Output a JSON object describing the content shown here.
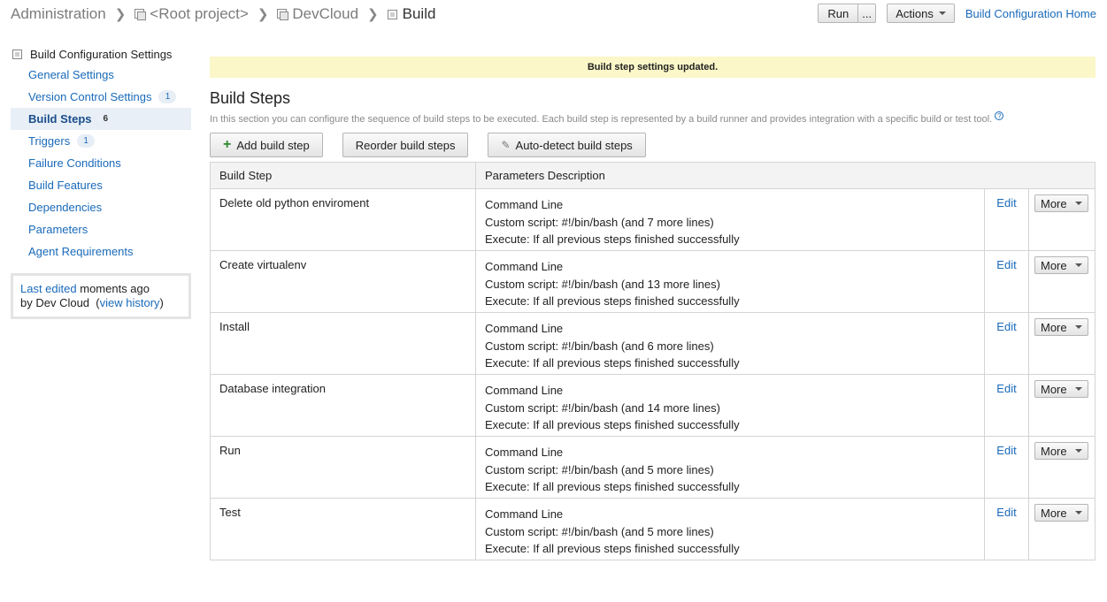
{
  "breadcrumb": [
    {
      "label": "Administration",
      "icon": ""
    },
    {
      "label": "<Root project>",
      "icon": "project-icon"
    },
    {
      "label": "DevCloud",
      "icon": "project-icon"
    },
    {
      "label": "Build",
      "icon": "build-config-icon"
    }
  ],
  "header": {
    "run_label": "Run",
    "run_more_label": "...",
    "actions_label": "Actions",
    "home_link": "Build Configuration Home"
  },
  "sidebar": {
    "title": "Build Configuration Settings",
    "items": [
      {
        "label": "General Settings",
        "badge": ""
      },
      {
        "label": "Version Control Settings",
        "badge": "1"
      },
      {
        "label": "Build Steps",
        "badge": "6",
        "active": true
      },
      {
        "label": "Triggers",
        "badge": "1"
      },
      {
        "label": "Failure Conditions",
        "badge": ""
      },
      {
        "label": "Build Features",
        "badge": ""
      },
      {
        "label": "Dependencies",
        "badge": ""
      },
      {
        "label": "Parameters",
        "badge": ""
      },
      {
        "label": "Agent Requirements",
        "badge": ""
      }
    ],
    "last_edited": {
      "link": "Last edited",
      "time": "moments ago",
      "by": "by Dev Cloud",
      "history_link": "view history"
    }
  },
  "main": {
    "notice": "Build step settings updated.",
    "title": "Build Steps",
    "description": "In this section you can configure the sequence of build steps to be executed. Each build step is represented by a build runner and provides integration with a specific build or test tool.",
    "help_icon": "?",
    "buttons": {
      "add": "Add build step",
      "add_icon": "+",
      "reorder": "Reorder build steps",
      "autodetect": "Auto-detect build steps",
      "autodetect_icon": "✎"
    },
    "table": {
      "columns": [
        "Build Step",
        "Parameters Description"
      ],
      "edit_label": "Edit",
      "more_label": "More",
      "rows": [
        {
          "name": "Delete old python enviroment",
          "runner": "Command Line",
          "script": "Custom script: #!/bin/bash (and 7 more lines)",
          "execute": "Execute: If all previous steps finished successfully"
        },
        {
          "name": "Create virtualenv",
          "runner": "Command Line",
          "script": "Custom script: #!/bin/bash (and 13 more lines)",
          "execute": "Execute: If all previous steps finished successfully"
        },
        {
          "name": "Install",
          "runner": "Command Line",
          "script": "Custom script: #!/bin/bash (and 6 more lines)",
          "execute": "Execute: If all previous steps finished successfully"
        },
        {
          "name": "Database integration",
          "runner": "Command Line",
          "script": "Custom script: #!/bin/bash (and 14 more lines)",
          "execute": "Execute: If all previous steps finished successfully"
        },
        {
          "name": "Run",
          "runner": "Command Line",
          "script": "Custom script: #!/bin/bash (and 5 more lines)",
          "execute": "Execute: If all previous steps finished successfully"
        },
        {
          "name": "Test",
          "runner": "Command Line",
          "script": "Custom script: #!/bin/bash (and 5 more lines)",
          "execute": "Execute: If all previous steps finished successfully"
        }
      ]
    }
  }
}
